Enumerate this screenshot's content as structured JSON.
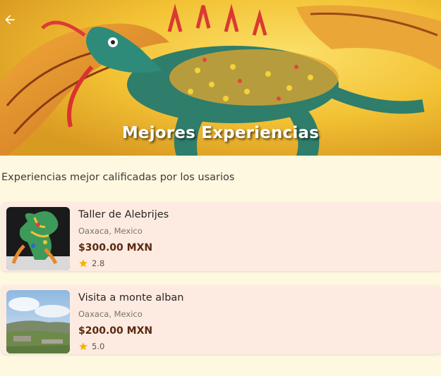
{
  "header": {
    "title": "Mejores Experiencias",
    "back_icon": "arrow-left-icon"
  },
  "subtitle": "Experiencias mejor calificadas por los usarios",
  "experiences": [
    {
      "title": "Taller de Alebrijes",
      "location": "Oaxaca, Mexico",
      "price": "$300.00 MXN",
      "rating": "2.8",
      "image": "alebrije-figure-photo"
    },
    {
      "title": "Visita a monte alban",
      "location": "Oaxaca, Mexico",
      "price": "$200.00 MXN",
      "rating": "5.0",
      "image": "monte-alban-landscape-photo"
    }
  ],
  "colors": {
    "background": "#fff8e1",
    "card": "#fdebe2",
    "star": "#f5b400",
    "price": "#5a2a10"
  }
}
